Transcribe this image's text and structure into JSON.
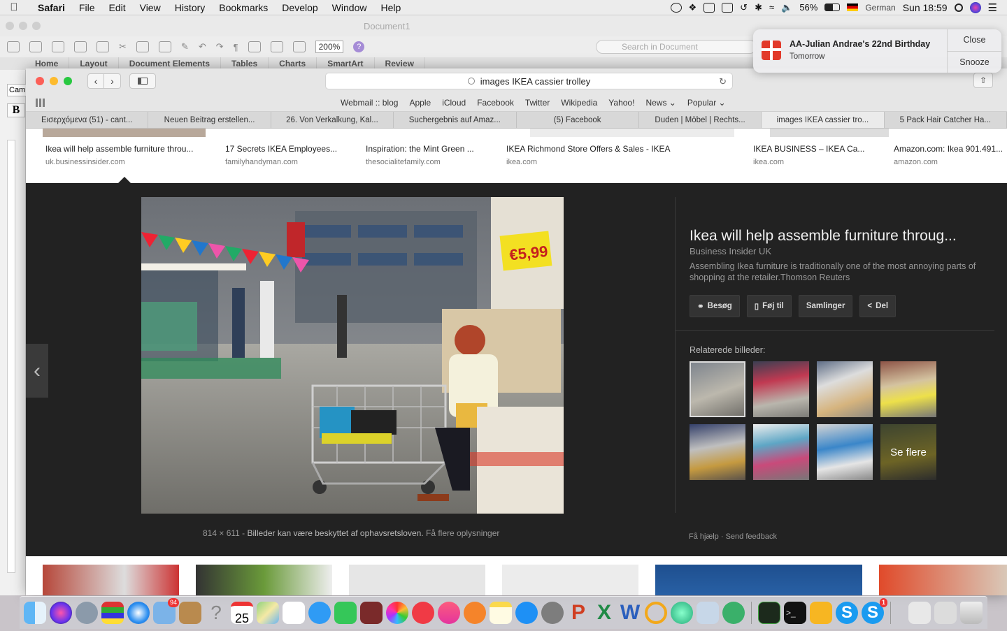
{
  "menubar": {
    "app": "Safari",
    "items": [
      "File",
      "Edit",
      "View",
      "History",
      "Bookmarks",
      "Develop",
      "Window",
      "Help"
    ],
    "battery": "56%",
    "input_source": "German",
    "clock": "Sun 18:59"
  },
  "word": {
    "doc_title": "Document1",
    "zoom": "200%",
    "search_placeholder": "Search in Document",
    "ribbon_tabs": [
      "Home",
      "Layout",
      "Document Elements",
      "Tables",
      "Charts",
      "SmartArt",
      "Review"
    ],
    "font_box": "Cam",
    "bold": "B"
  },
  "notification": {
    "title": "AA-Julian Andrae's 22nd Birthday",
    "subtitle": "Tomorrow",
    "close": "Close",
    "snooze": "Snooze"
  },
  "safari": {
    "url": "images  IKEA cassier trolley",
    "favorites": [
      "Webmail :: blog",
      "Apple",
      "iCloud",
      "Facebook",
      "Twitter",
      "Wikipedia",
      "Yahoo!",
      "News ⌄",
      "Popular ⌄"
    ],
    "tabs": [
      {
        "label": "Εισερχόμενα (51) - cant...",
        "active": false
      },
      {
        "label": "Neuen Beitrag erstellen...",
        "active": false
      },
      {
        "label": "26. Von Verkalkung, Kal...",
        "active": false
      },
      {
        "label": "Suchergebnis auf Amaz...",
        "active": false
      },
      {
        "label": "(5) Facebook",
        "active": false
      },
      {
        "label": "Duden | Möbel | Rechts...",
        "active": false
      },
      {
        "label": "images IKEA cassier tro...",
        "active": true
      },
      {
        "label": "5 Pack Hair Catcher Ha...",
        "active": false
      }
    ]
  },
  "results_top": [
    {
      "title": "Ikea will help assemble furniture throu...",
      "source": "uk.businessinsider.com"
    },
    {
      "title": "17 Secrets IKEA Employees...",
      "source": "familyhandyman.com"
    },
    {
      "title": "Inspiration: the Mint Green ...",
      "source": "thesocialitefamily.com"
    },
    {
      "title": "IKEA Richmond Store Offers & Sales - IKEA",
      "source": "ikea.com"
    },
    {
      "title": "IKEA BUSINESS – IKEA Ca...",
      "source": "ikea.com"
    },
    {
      "title": "Amazon.com: Ikea 901.491...",
      "source": "amazon.com"
    }
  ],
  "preview": {
    "title": "Ikea will help assemble furniture throug...",
    "source": "Business Insider UK",
    "description": "Assembling Ikea furniture is traditionally one of the most annoying parts of shopping at the retailer.Thomson Reuters",
    "actions": [
      {
        "icon": "globe-icon",
        "label": "Besøg"
      },
      {
        "icon": "bookmark-icon",
        "label": "Føj til"
      },
      {
        "icon": "",
        "label": "Samlinger"
      },
      {
        "icon": "share-icon",
        "label": "Del"
      }
    ],
    "related_label": "Relaterede billeder:",
    "see_more": "Se flere",
    "dimensions": "814 × 611",
    "copyright": "Billeder kan være beskyttet af ophavsretsloven.",
    "more_info": "Få flere oplysninger",
    "help": "Få hjælp",
    "feedback": "Send feedback",
    "price_tag": "€5,99"
  },
  "dock": {
    "calendar_day": "25",
    "mail_badge": "94",
    "skype_badge": "1"
  }
}
